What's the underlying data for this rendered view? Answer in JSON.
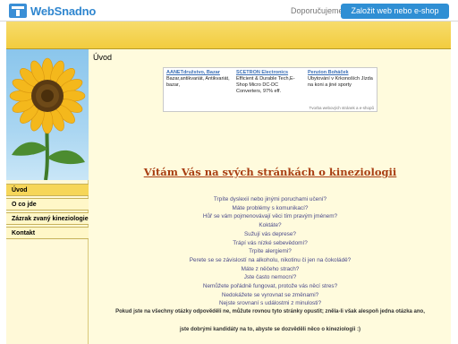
{
  "topbar": {
    "logo_text": "WebSnadno",
    "recommend_label": "Doporučujeme",
    "cta_label": "Založit web nebo e-shop"
  },
  "colors": {
    "accent": "#2f8fd4",
    "header_band": "#f2cc3e",
    "page_bg": "#fffbdd",
    "welcome_text": "#a83e12",
    "question_text": "#4a4a8a"
  },
  "main": {
    "heading": "Úvod",
    "ads": [
      {
        "title": "AANETdružstvo, Bazar",
        "text": "Bazar,antikvariát, Antikvariát, bazar,"
      },
      {
        "title": "SCETRON Electronics",
        "text": "Efficient & Durable Tech,E-Shop Micro DC-DC Converters, 97% eff."
      },
      {
        "title": "Penzion Boháček",
        "text": "Ubytování v Krkonoších Jízda na koni a jiné sporty"
      }
    ],
    "ads_footer": "Tvorba webových stránek a e-shopů",
    "welcome": "Vítám Vás na svých stránkách o kineziologii",
    "questions": [
      "Trpíte dyslexií nebo jinými poruchami učení?",
      "Máte problémy s komunikací?",
      "Hůř se vám pojmenovávají věci tím pravým jménem?",
      "Koktáte?",
      "Sužují vás deprese?",
      "Trápí vás nízké sebevědomí?",
      "Trpíte alergiemi?",
      "Perete se se závislostí na alkoholu, nikotinu či jen na čokoládě?",
      "Máte z něčeho strach?",
      "Jste často nemocní?",
      "Nemůžete pořádně fungovat, protože vás něcí stres?",
      "Nedokážete se vyrovnat se změnami?",
      "Nejste srovnaní s událostmi z minulosti?"
    ],
    "closing_1": "Pokud jste na všechny otázky odpověděli ne, můžute rovnou tyto stránky opustit; zněla-li však alespoň jedna otázka ano,",
    "closing_2": "jste dobrými kandidáty na to, abyste se dozvěděli něco o kineziologii :)"
  },
  "sidebar": {
    "items": [
      {
        "label": "Úvod"
      },
      {
        "label": "O co jde"
      },
      {
        "label": "Zázrak zvaný kineziologie"
      },
      {
        "label": "Kontakt"
      }
    ]
  }
}
